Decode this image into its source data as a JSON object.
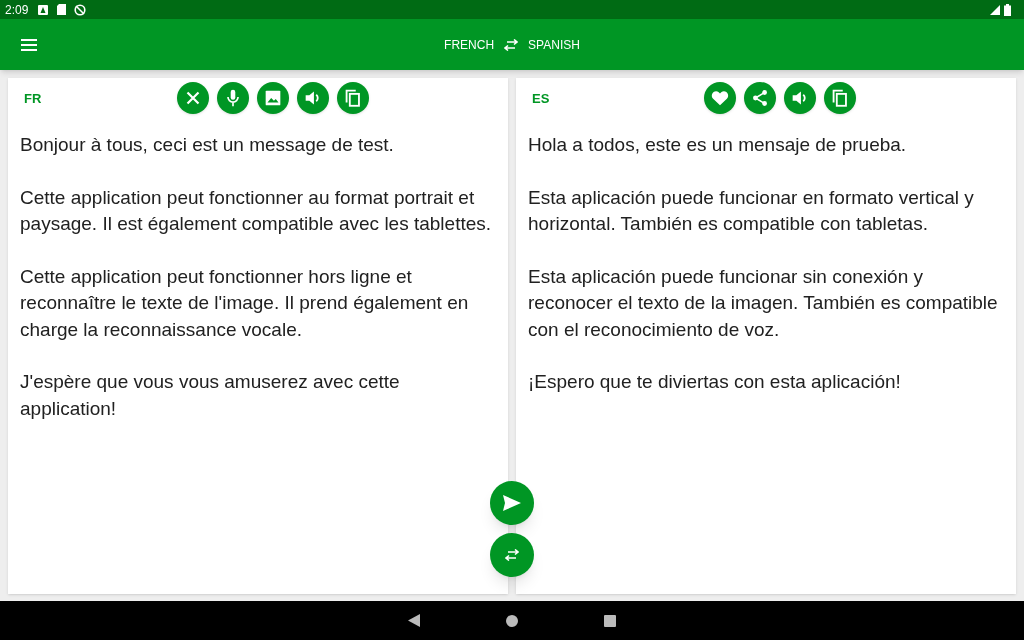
{
  "status_bar": {
    "time": "2:09"
  },
  "app_bar": {
    "source_language": "FRENCH",
    "target_language": "SPANISH"
  },
  "panels": [
    {
      "code": "FR",
      "actions": [
        {
          "kind": "clear"
        },
        {
          "kind": "mic"
        },
        {
          "kind": "image"
        },
        {
          "kind": "speak"
        },
        {
          "kind": "copy"
        }
      ],
      "paragraphs": [
        "Bonjour à tous, ceci est un message de test.",
        "Cette application peut fonctionner au format portrait et paysage. Il est également compatible avec les tablettes.",
        "Cette application peut fonctionner hors ligne et reconnaître le texte de l'image. Il prend également en charge la reconnaissance vocale.",
        "J'espère que vous vous amuserez avec cette application!"
      ]
    },
    {
      "code": "ES",
      "actions": [
        {
          "kind": "favorite"
        },
        {
          "kind": "share"
        },
        {
          "kind": "speak"
        },
        {
          "kind": "copy"
        }
      ],
      "paragraphs": [
        "Hola a todos, este es un mensaje de prueba.",
        "Esta aplicación puede funcionar en formato vertical y horizontal. También es compatible con tabletas.",
        "Esta aplicación puede funcionar sin conexión y reconocer el texto de la imagen. También es compatible con el reconocimiento de voz.",
        "¡Espero que te diviertas con esta aplicación!"
      ]
    }
  ]
}
